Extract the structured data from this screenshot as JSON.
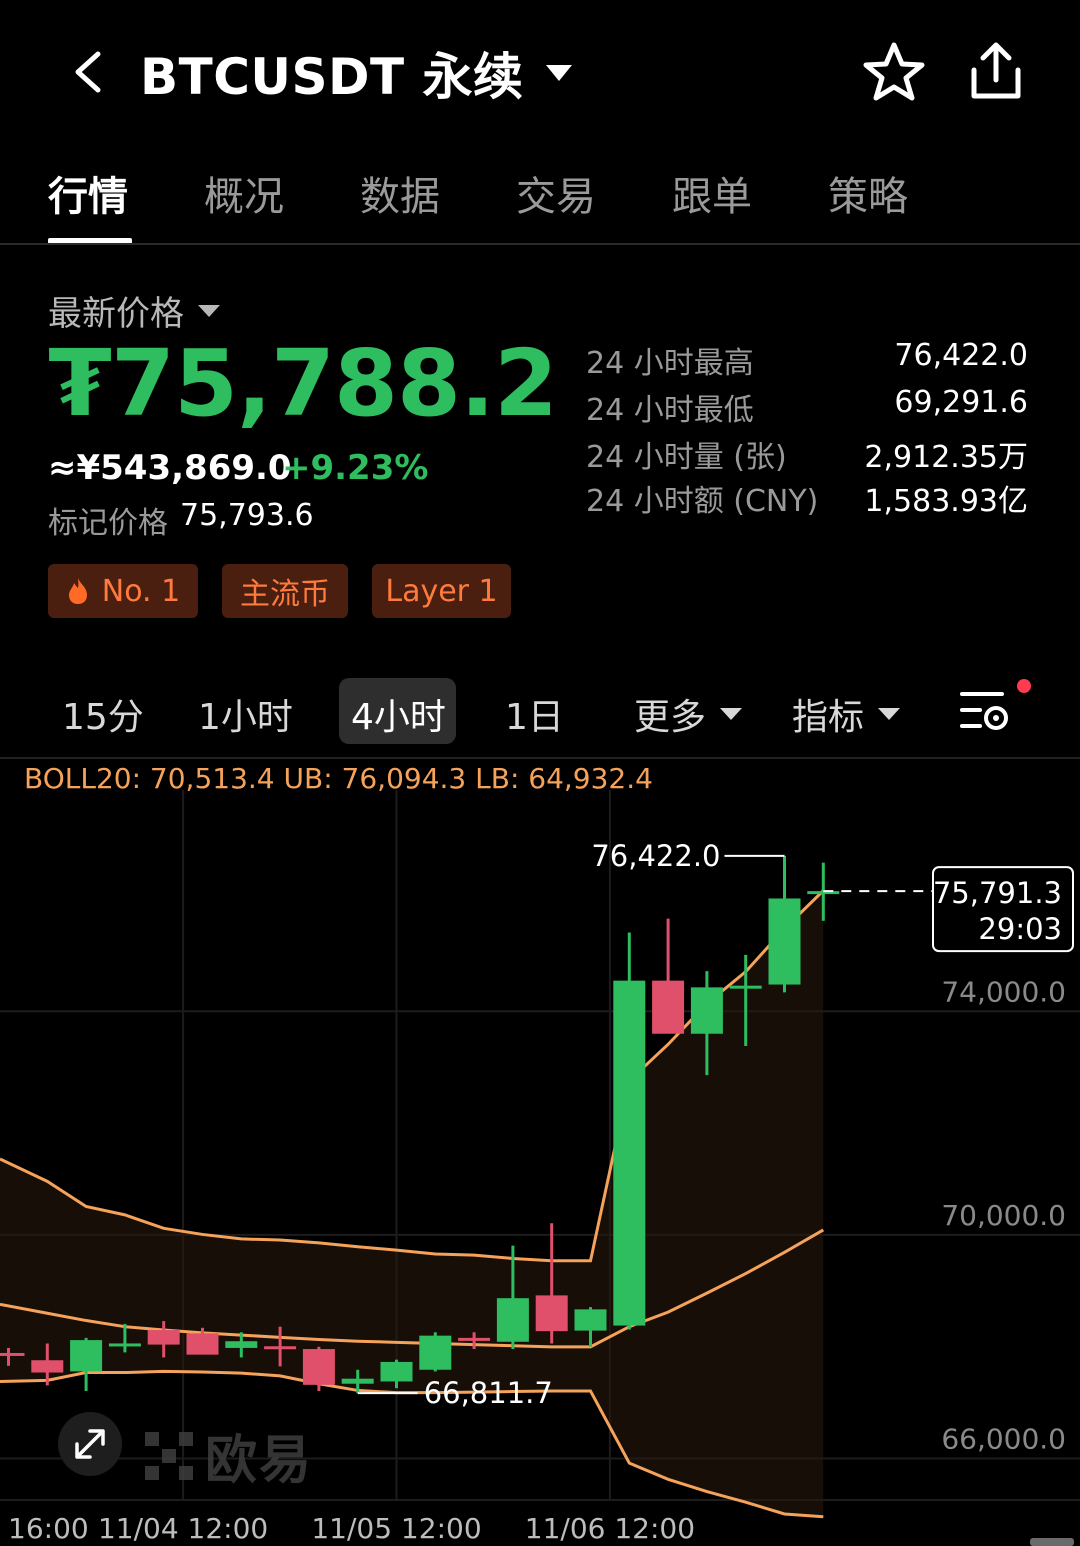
{
  "header": {
    "title": "BTCUSDT 永续"
  },
  "tabs": [
    "行情",
    "概况",
    "数据",
    "交易",
    "跟单",
    "策略"
  ],
  "price_block": {
    "latest_label": "最新价格",
    "last_price": "₮75,788.2",
    "approx_cny": "≈¥543,869.0",
    "change_pct": "+9.23%",
    "mark_label": "标记价格",
    "mark_value": "75,793.6"
  },
  "stats": [
    {
      "label": "24 小时最高",
      "value": "76,422.0"
    },
    {
      "label": "24 小时最低",
      "value": "69,291.6"
    },
    {
      "label": "24 小时量 (张)",
      "value": "2,912.35万"
    },
    {
      "label": "24 小时额 (CNY)",
      "value": "1,583.93亿"
    }
  ],
  "tags": [
    "No. 1",
    "主流币",
    "Layer 1"
  ],
  "intervals": {
    "items": [
      "15分",
      "1小时",
      "4小时",
      "1日"
    ],
    "active": "4小时",
    "more": "更多",
    "indicator": "指标"
  },
  "colors": {
    "up": "#2ebd5f",
    "down": "#e0506a",
    "boll": "#f5a35a",
    "tag_text": "#ff7a3d"
  },
  "chart_data": {
    "type": "candlestick",
    "indicator_text": "BOLL20: 70,513.4  UB: 76,094.3  LB: 64,932.4",
    "ylim": [
      64900,
      77600
    ],
    "y_ticks": [
      "74,000.0",
      "70,000.0",
      "66,000.0"
    ],
    "y_tick_values": [
      74000,
      70000,
      66000
    ],
    "x_ticks": [
      "16:00",
      "11/04 12:00",
      "11/05 12:00",
      "11/06 12:00"
    ],
    "x_tick_index": [
      -1,
      4.5,
      10,
      15.5
    ],
    "current_price_label": "75,791.3",
    "countdown": "29:03",
    "current_price": 75791.3,
    "high_label": "76,422.0",
    "high_value": 76422.0,
    "high_index": 20,
    "low_label": "66,811.7",
    "low_value": 66811.7,
    "low_index": 9,
    "candles": [
      {
        "o": 67530,
        "h": 67620,
        "l": 67300,
        "c": 67500
      },
      {
        "o": 67400,
        "h": 67700,
        "l": 66950,
        "c": 67180
      },
      {
        "o": 67200,
        "h": 67800,
        "l": 66850,
        "c": 67760
      },
      {
        "o": 67660,
        "h": 68050,
        "l": 67540,
        "c": 67700
      },
      {
        "o": 67940,
        "h": 68100,
        "l": 67450,
        "c": 67680
      },
      {
        "o": 67880,
        "h": 67980,
        "l": 67510,
        "c": 67500
      },
      {
        "o": 67620,
        "h": 67900,
        "l": 67450,
        "c": 67740
      },
      {
        "o": 67650,
        "h": 68000,
        "l": 67290,
        "c": 67600
      },
      {
        "o": 67600,
        "h": 67640,
        "l": 66850,
        "c": 66960
      },
      {
        "o": 66980,
        "h": 67230,
        "l": 66811.7,
        "c": 67070
      },
      {
        "o": 67020,
        "h": 67410,
        "l": 66900,
        "c": 67370
      },
      {
        "o": 67230,
        "h": 67900,
        "l": 67200,
        "c": 67840
      },
      {
        "o": 67800,
        "h": 67900,
        "l": 67600,
        "c": 67770
      },
      {
        "o": 67730,
        "h": 69450,
        "l": 67600,
        "c": 68510
      },
      {
        "o": 68560,
        "h": 69850,
        "l": 67700,
        "c": 67920
      },
      {
        "o": 67930,
        "h": 68350,
        "l": 67640,
        "c": 68310
      },
      {
        "o": 68020,
        "h": 75050,
        "l": 67950,
        "c": 74190
      },
      {
        "o": 74190,
        "h": 75300,
        "l": 73270,
        "c": 73240
      },
      {
        "o": 73240,
        "h": 74360,
        "l": 72500,
        "c": 74070
      },
      {
        "o": 74070,
        "h": 74650,
        "l": 73020,
        "c": 74100
      },
      {
        "o": 74120,
        "h": 76422.0,
        "l": 73980,
        "c": 75660
      },
      {
        "o": 75780,
        "h": 76300,
        "l": 75260,
        "c": 75791.3
      }
    ],
    "boll_upper": [
      71000,
      70600,
      70150,
      70000,
      69760,
      69650,
      69570,
      69550,
      69500,
      69430,
      69370,
      69300,
      69280,
      69220,
      69180,
      69180,
      72400,
      73050,
      73780,
      74350,
      75120,
      75800
    ],
    "boll_middle": [
      68400,
      68240,
      68110,
      68000,
      67940,
      67890,
      67850,
      67810,
      67770,
      67740,
      67720,
      67700,
      67680,
      67660,
      67640,
      67640,
      68000,
      68260,
      68600,
      68950,
      69330,
      69730
    ],
    "boll_lower": [
      67020,
      67040,
      67180,
      67180,
      67200,
      67190,
      67170,
      67120,
      66980,
      66860,
      66820,
      66820,
      66830,
      66840,
      66850,
      66850,
      65560,
      65270,
      65050,
      64860,
      64650,
      64600
    ]
  }
}
